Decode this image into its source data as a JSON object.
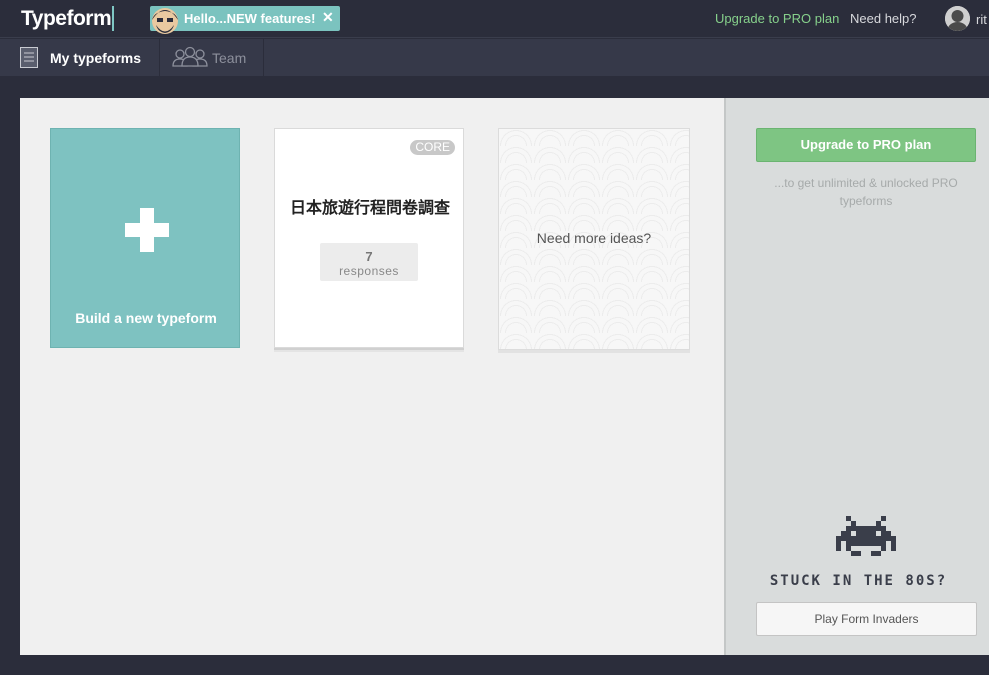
{
  "header": {
    "logo": "Typeform",
    "announcement": {
      "text": "Hello...NEW features!",
      "close": "✕"
    },
    "upgrade_link": "Upgrade to PRO plan",
    "help_link": "Need help?",
    "user_name": "rit"
  },
  "tabs": [
    {
      "label": "My typeforms",
      "icon": "document-icon",
      "active": true
    },
    {
      "label": "Team",
      "icon": "people-icon",
      "active": false
    }
  ],
  "main": {
    "new_card": {
      "label": "Build a new typeform"
    },
    "form_card": {
      "badge": "CORE",
      "title": "日本旅遊行程問卷調查",
      "responses_count": "7",
      "responses_label": "responses"
    },
    "ideas_card": {
      "label": "Need more ideas?"
    }
  },
  "sidebar": {
    "upgrade_button": "Upgrade to PRO plan",
    "upgrade_note": "...to get unlimited & unlocked PRO typeforms",
    "stuck_text": "STUCK IN THE 80S?",
    "play_button": "Play Form Invaders"
  },
  "colors": {
    "topbar": "#2b2d3b",
    "accent_teal": "#7ec2c1",
    "upgrade_green": "#7ec583",
    "main_bg": "#f0f0f0",
    "sidebar_bg": "#d9dcdc"
  }
}
